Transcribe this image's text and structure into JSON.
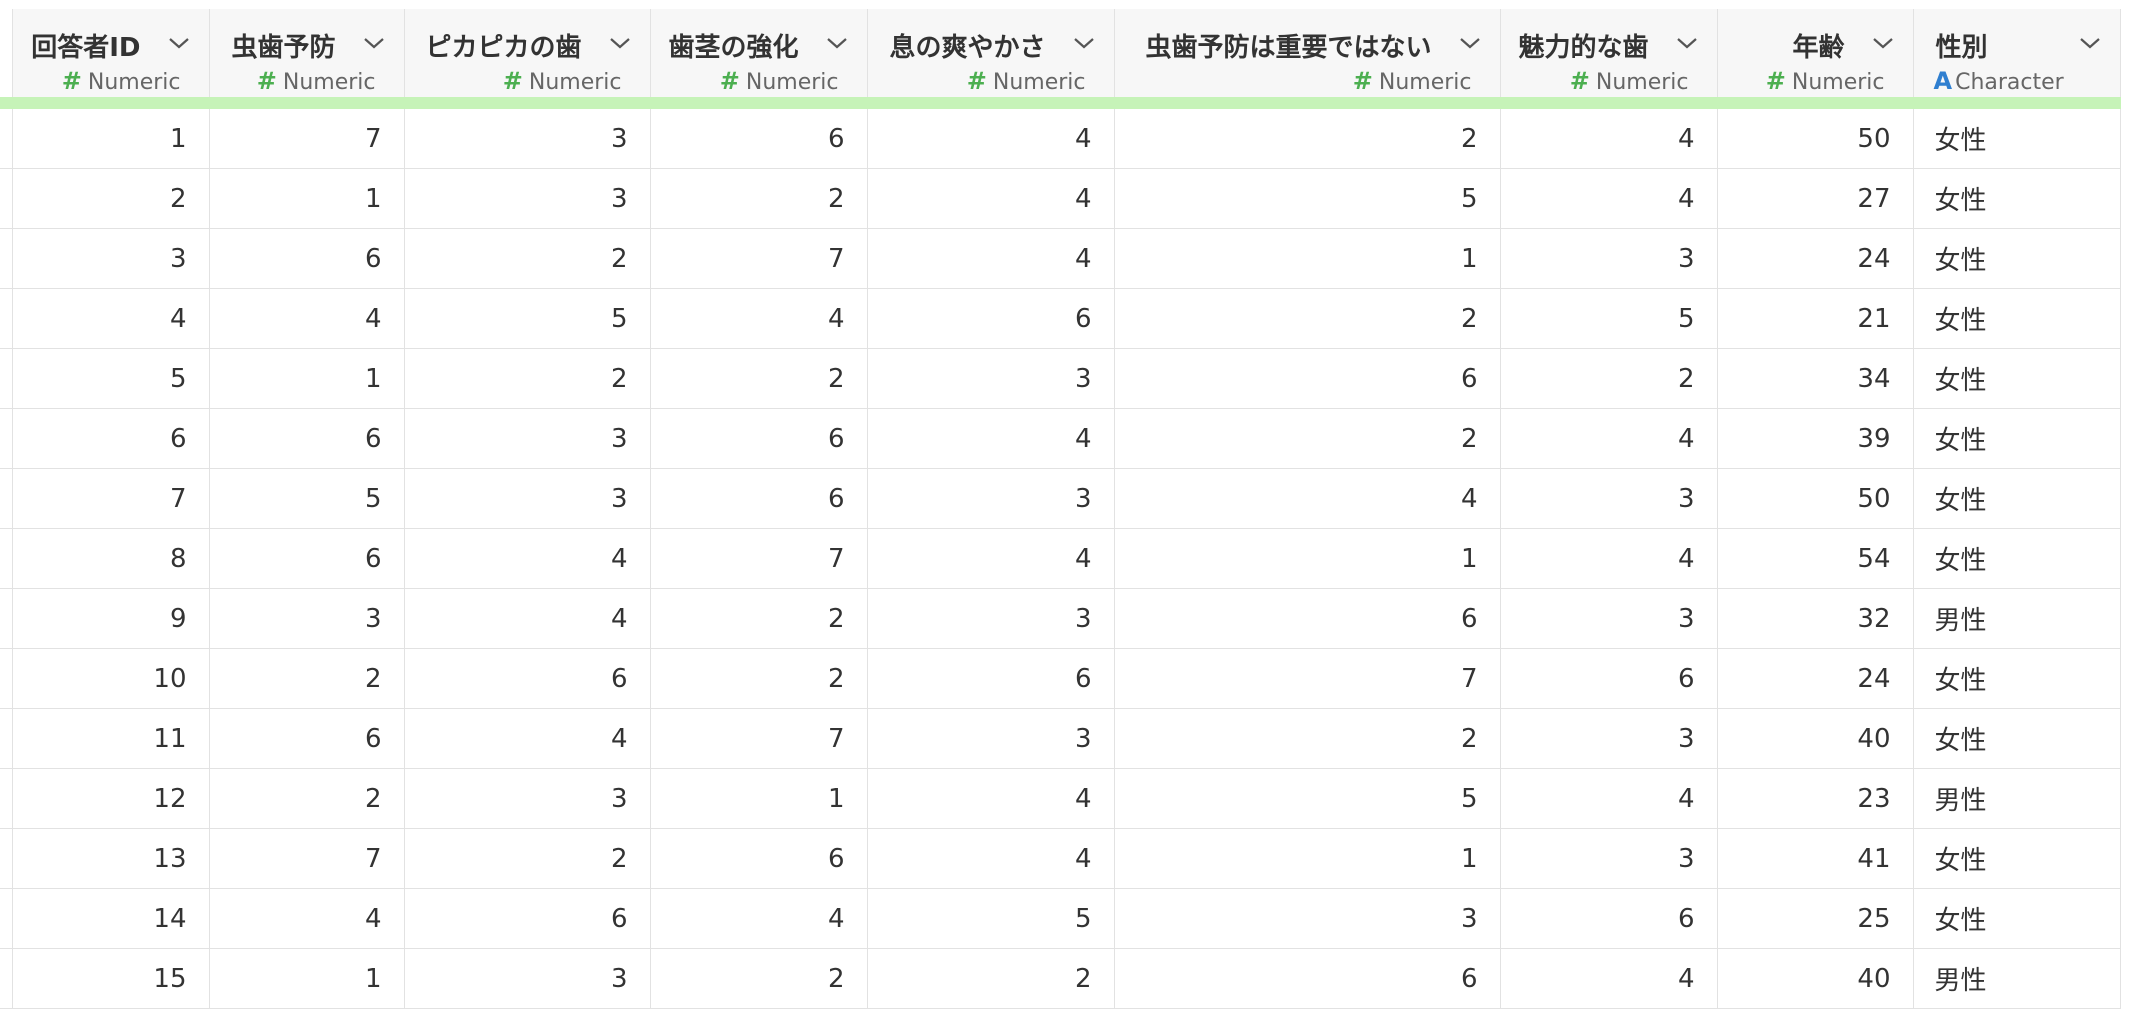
{
  "columns": [
    {
      "title": "回答者ID",
      "type": "Numeric",
      "type_icon": "hash-icon"
    },
    {
      "title": "虫歯予防",
      "type": "Numeric",
      "type_icon": "hash-icon"
    },
    {
      "title": "ピカピカの歯",
      "type": "Numeric",
      "type_icon": "hash-icon"
    },
    {
      "title": "歯茎の強化",
      "type": "Numeric",
      "type_icon": "hash-icon"
    },
    {
      "title": "息の爽やかさ",
      "type": "Numeric",
      "type_icon": "hash-icon"
    },
    {
      "title": "虫歯予防は重要ではない",
      "type": "Numeric",
      "type_icon": "hash-icon"
    },
    {
      "title": "魅力的な歯",
      "type": "Numeric",
      "type_icon": "hash-icon"
    },
    {
      "title": "年齢",
      "type": "Numeric",
      "type_icon": "hash-icon"
    },
    {
      "title": "性別",
      "type": "Character",
      "type_icon": "character-a-icon"
    }
  ],
  "icons": {
    "hash": "#",
    "character": "A",
    "menu": "chevron-down-icon"
  },
  "colors": {
    "header_bg": "#f7f7f7",
    "header_underline": "#c6f3b8",
    "numeric_icon": "#4caf50",
    "character_icon": "#2f7fd0",
    "grid_line": "#e2e2e2"
  },
  "rows": [
    [
      "1",
      "7",
      "3",
      "6",
      "4",
      "2",
      "4",
      "50",
      "女性"
    ],
    [
      "2",
      "1",
      "3",
      "2",
      "4",
      "5",
      "4",
      "27",
      "女性"
    ],
    [
      "3",
      "6",
      "2",
      "7",
      "4",
      "1",
      "3",
      "24",
      "女性"
    ],
    [
      "4",
      "4",
      "5",
      "4",
      "6",
      "2",
      "5",
      "21",
      "女性"
    ],
    [
      "5",
      "1",
      "2",
      "2",
      "3",
      "6",
      "2",
      "34",
      "女性"
    ],
    [
      "6",
      "6",
      "3",
      "6",
      "4",
      "2",
      "4",
      "39",
      "女性"
    ],
    [
      "7",
      "5",
      "3",
      "6",
      "3",
      "4",
      "3",
      "50",
      "女性"
    ],
    [
      "8",
      "6",
      "4",
      "7",
      "4",
      "1",
      "4",
      "54",
      "女性"
    ],
    [
      "9",
      "3",
      "4",
      "2",
      "3",
      "6",
      "3",
      "32",
      "男性"
    ],
    [
      "10",
      "2",
      "6",
      "2",
      "6",
      "7",
      "6",
      "24",
      "女性"
    ],
    [
      "11",
      "6",
      "4",
      "7",
      "3",
      "2",
      "3",
      "40",
      "女性"
    ],
    [
      "12",
      "2",
      "3",
      "1",
      "4",
      "5",
      "4",
      "23",
      "男性"
    ],
    [
      "13",
      "7",
      "2",
      "6",
      "4",
      "1",
      "3",
      "41",
      "女性"
    ],
    [
      "14",
      "4",
      "6",
      "4",
      "5",
      "3",
      "6",
      "25",
      "女性"
    ],
    [
      "15",
      "1",
      "3",
      "2",
      "2",
      "6",
      "4",
      "40",
      "男性"
    ]
  ]
}
